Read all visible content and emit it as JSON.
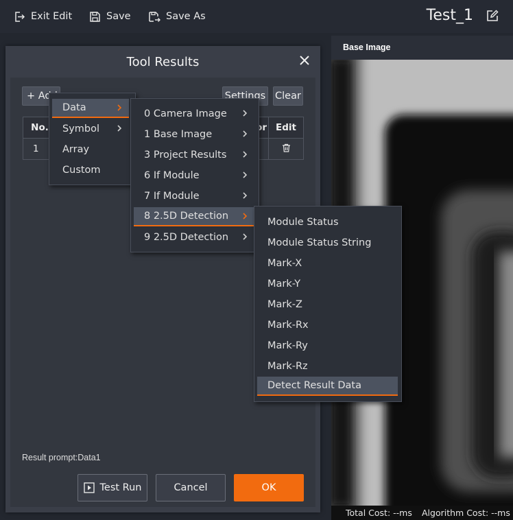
{
  "toolbar": {
    "exit_edit": "Exit Edit",
    "save": "Save",
    "save_as": "Save As",
    "project_title": "Test_1"
  },
  "image_panel": {
    "header": "Base Image",
    "total_cost": "Total Cost: --ms",
    "algorithm_cost": "Algorithm Cost: --ms"
  },
  "dialog": {
    "title": "Tool Results",
    "add_label": "+ Add",
    "settings_label": "Settings",
    "clear_label": "Clear",
    "columns": [
      "No.",
      "or",
      "Edit"
    ],
    "rows": [
      {
        "no": "1"
      }
    ],
    "result_prompt": "Result prompt:Data1",
    "test_run": "Test Run",
    "cancel": "Cancel",
    "ok": "OK"
  },
  "menu_l1": [
    "Data",
    "Symbol",
    "Array",
    "Custom"
  ],
  "menu_l2": [
    "0 Camera Image",
    "1 Base Image",
    "3 Project Results",
    "6 If Module",
    "7 If Module",
    "8 2.5D Detection",
    "9 2.5D Detection"
  ],
  "menu_l3": [
    "Module Status",
    "Module Status String",
    "Mark-X",
    "Mark-Y",
    "Mark-Z",
    "Mark-Rx",
    "Mark-Ry",
    "Mark-Rz",
    "Detect Result Data"
  ],
  "colors": {
    "accent": "#f26b0f",
    "background": "#23272f",
    "dialog": "#3a3e48",
    "menu": "#2c3038",
    "menu_highlight": "#4c5360"
  }
}
